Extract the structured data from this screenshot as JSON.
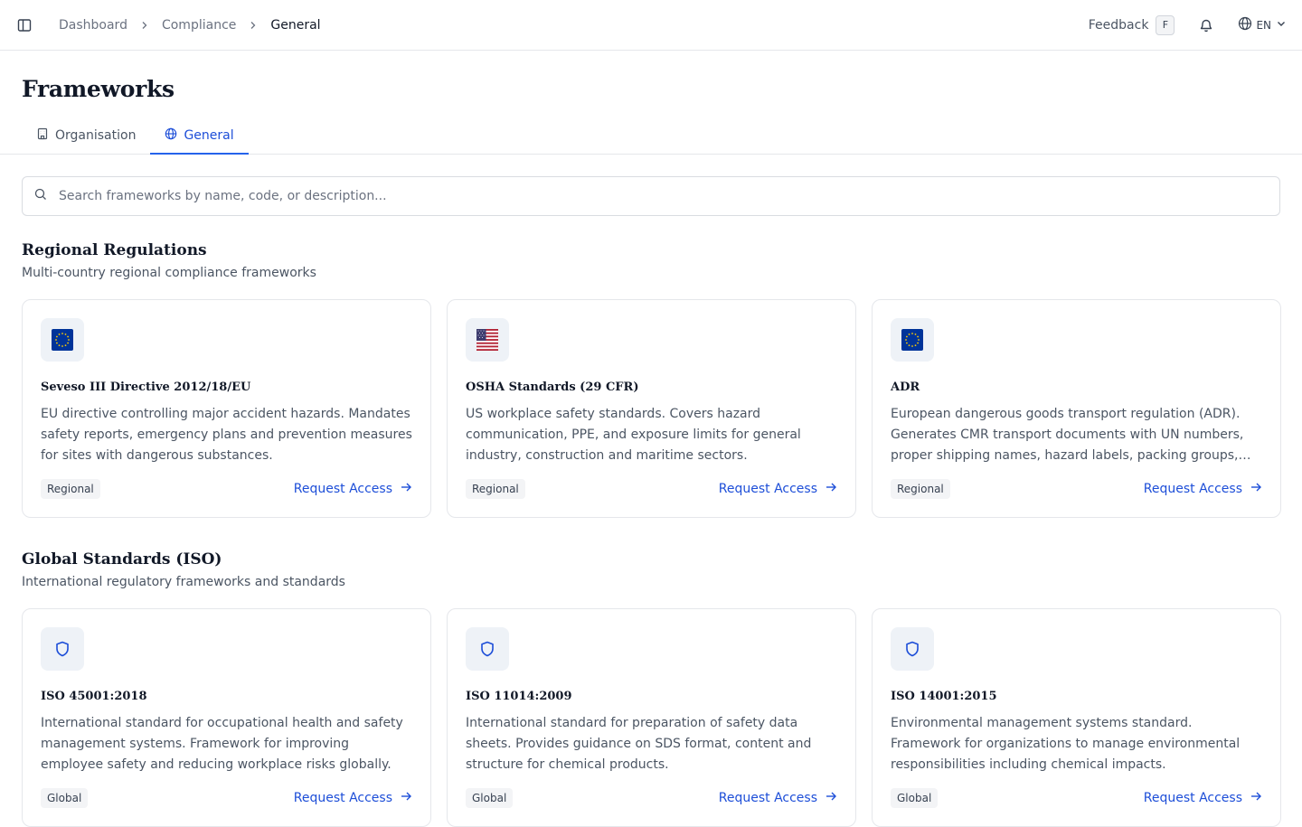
{
  "topbar": {
    "breadcrumb": [
      "Dashboard",
      "Compliance",
      "General"
    ],
    "feedback_label": "Feedback",
    "feedback_shortcut": "F",
    "language": "EN"
  },
  "page": {
    "title": "Frameworks",
    "tabs": [
      {
        "label": "Organisation",
        "icon": "building-icon",
        "active": false
      },
      {
        "label": "General",
        "icon": "globe-icon",
        "active": true
      }
    ],
    "search_placeholder": "Search frameworks by name, code, or description..."
  },
  "sections": [
    {
      "title": "Regional Regulations",
      "subtitle": "Multi-country regional compliance frameworks",
      "cards": [
        {
          "icon": "eu-flag-icon",
          "title": "Seveso III Directive 2012/18/EU",
          "description": "EU directive controlling major accident hazards. Mandates safety reports, emergency plans and prevention measures for sites with dangerous substances.",
          "badge": "Regional",
          "action": "Request Access"
        },
        {
          "icon": "us-flag-icon",
          "title": "OSHA Standards (29 CFR)",
          "description": "US workplace safety standards. Covers hazard communication, PPE, and exposure limits for general industry, construction and maritime sectors.",
          "badge": "Regional",
          "action": "Request Access"
        },
        {
          "icon": "eu-flag-icon",
          "title": "ADR",
          "description": "European dangerous goods transport regulation (ADR). Generates CMR transport documents with UN numbers, proper shipping names, hazard labels, packing groups, and...",
          "badge": "Regional",
          "action": "Request Access"
        }
      ]
    },
    {
      "title": "Global Standards (ISO)",
      "subtitle": "International regulatory frameworks and standards",
      "cards": [
        {
          "icon": "shield-icon",
          "title": "ISO 45001:2018",
          "description": "International standard for occupational health and safety management systems. Framework for improving employee safety and reducing workplace risks globally.",
          "badge": "Global",
          "action": "Request Access"
        },
        {
          "icon": "shield-icon",
          "title": "ISO 11014:2009",
          "description": "International standard for preparation of safety data sheets. Provides guidance on SDS format, content and structure for chemical products.",
          "badge": "Global",
          "action": "Request Access"
        },
        {
          "icon": "shield-icon",
          "title": "ISO 14001:2015",
          "description": "Environmental management systems standard. Framework for organizations to manage environmental responsibilities including chemical impacts.",
          "badge": "Global",
          "action": "Request Access"
        }
      ]
    }
  ],
  "colors": {
    "accent": "#2563eb",
    "eu_blue": "#003399",
    "eu_star": "#ffcc00",
    "us_red": "#b22234",
    "us_blue": "#3c3b6e"
  }
}
